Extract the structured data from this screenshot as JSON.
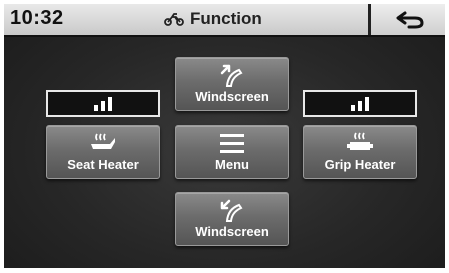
{
  "statusbar": {
    "time": "10:32",
    "title": "Function",
    "title_icon": "motorcycle-icon",
    "back_icon": "back-arrow-icon"
  },
  "buttons": {
    "windscreen_up": {
      "label": "Windscreen",
      "icon": "windscreen-up-icon"
    },
    "windscreen_down": {
      "label": "Windscreen",
      "icon": "windscreen-down-icon"
    },
    "seat_heater": {
      "label": "Seat Heater",
      "icon": "seat-heater-icon",
      "level": 3,
      "level_max": 3
    },
    "menu": {
      "label": "Menu",
      "icon": "menu-icon"
    },
    "grip_heater": {
      "label": "Grip Heater",
      "icon": "grip-heater-icon",
      "level": 3,
      "level_max": 3
    }
  },
  "colors": {
    "button": "#6c6c6c",
    "background": "#272727",
    "statusbar": "#d8d8d8",
    "text": "#ffffff"
  }
}
